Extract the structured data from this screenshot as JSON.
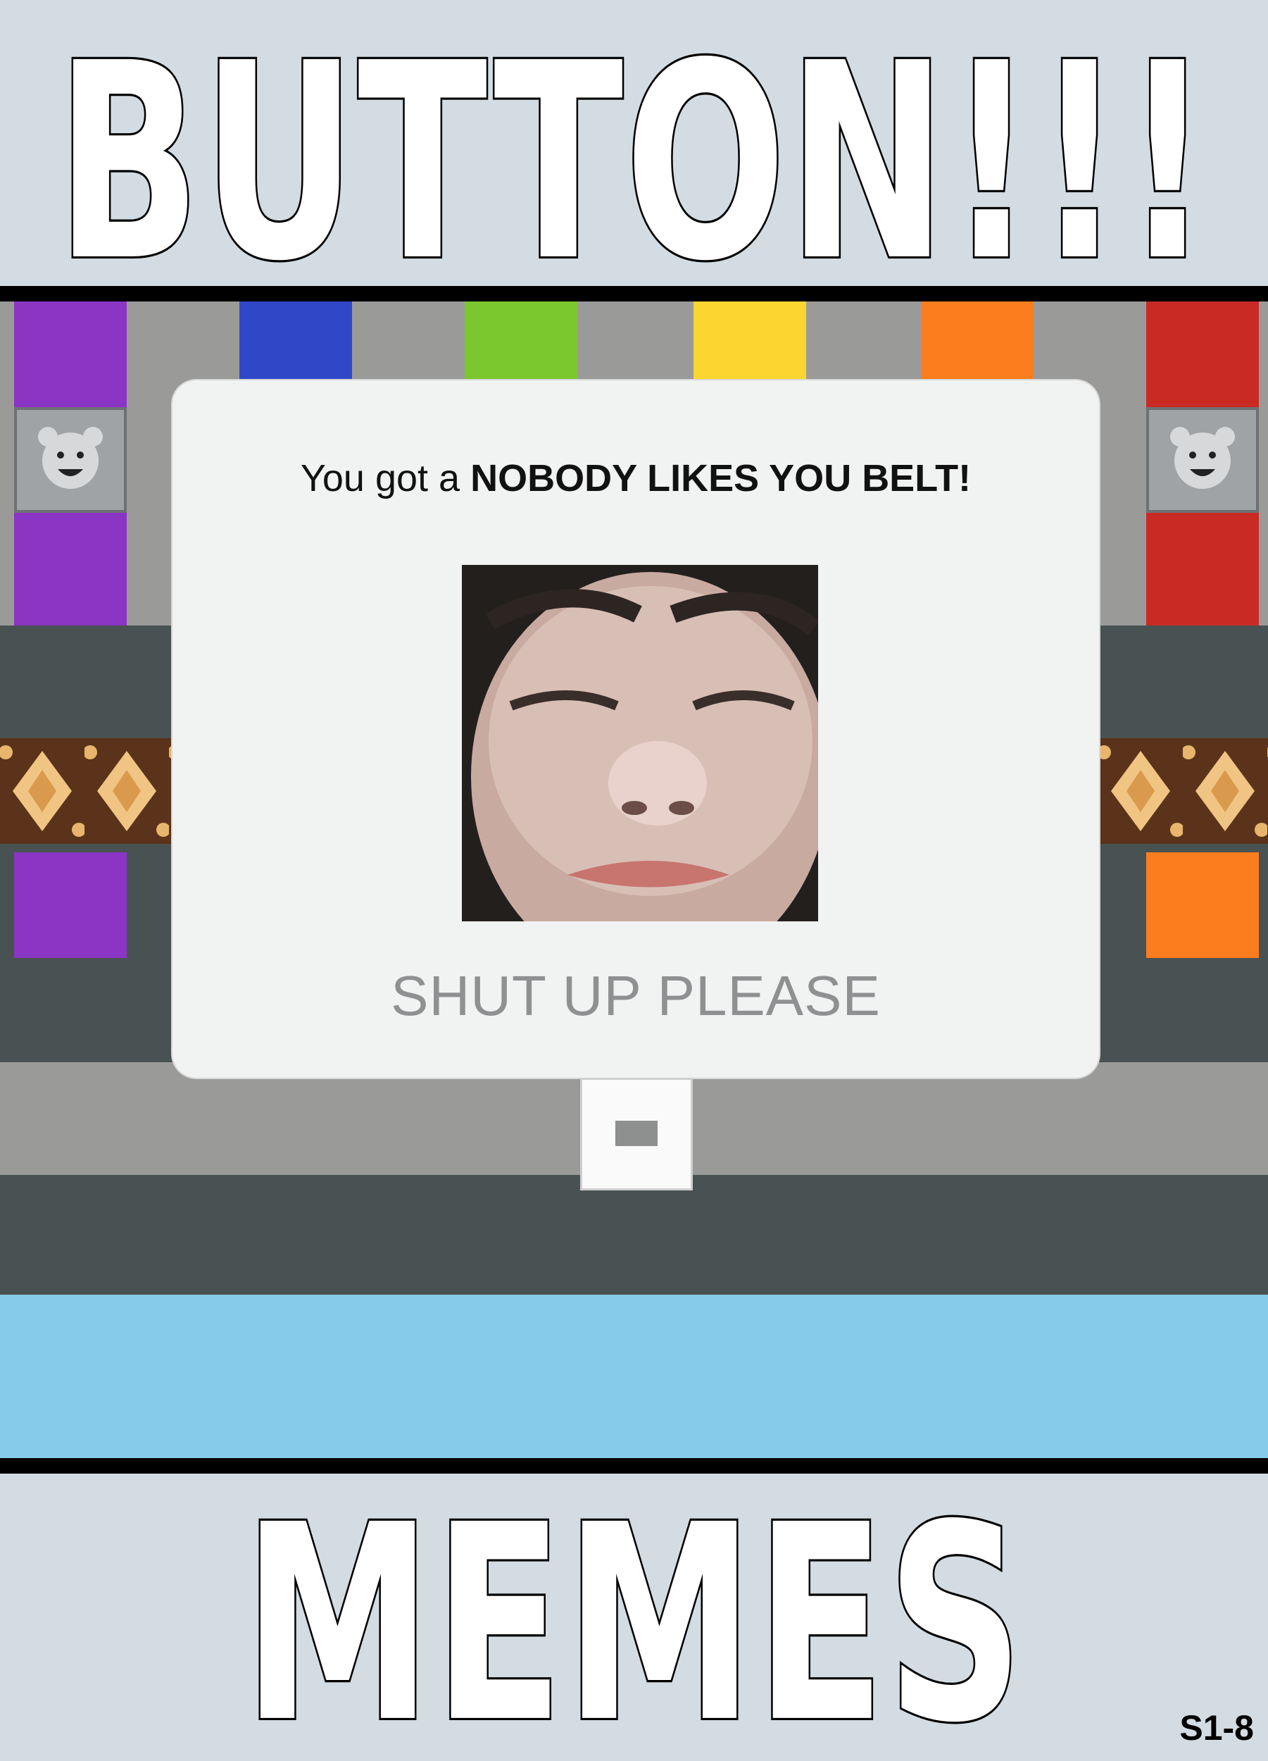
{
  "meme": {
    "top_text": "BUTTON!!!",
    "bottom_text": "MEMES",
    "label_code": "S1-8"
  },
  "dialog": {
    "title_prefix": "You got a ",
    "title_emphasis": "NOBODY LIKES YOU BELT!",
    "button_label": "SHUT UP PLEASE",
    "image_icon": "crying-face-photo"
  },
  "colors": {
    "background": "#d3dce2",
    "sky_band": "#86ccea",
    "dark_band": "#495253",
    "purple": "#8a35c3",
    "blue": "#3048c8",
    "green": "#7bc72e",
    "yellow": "#fdd531",
    "orange": "#fb7d1d",
    "red": "#c92b24"
  }
}
